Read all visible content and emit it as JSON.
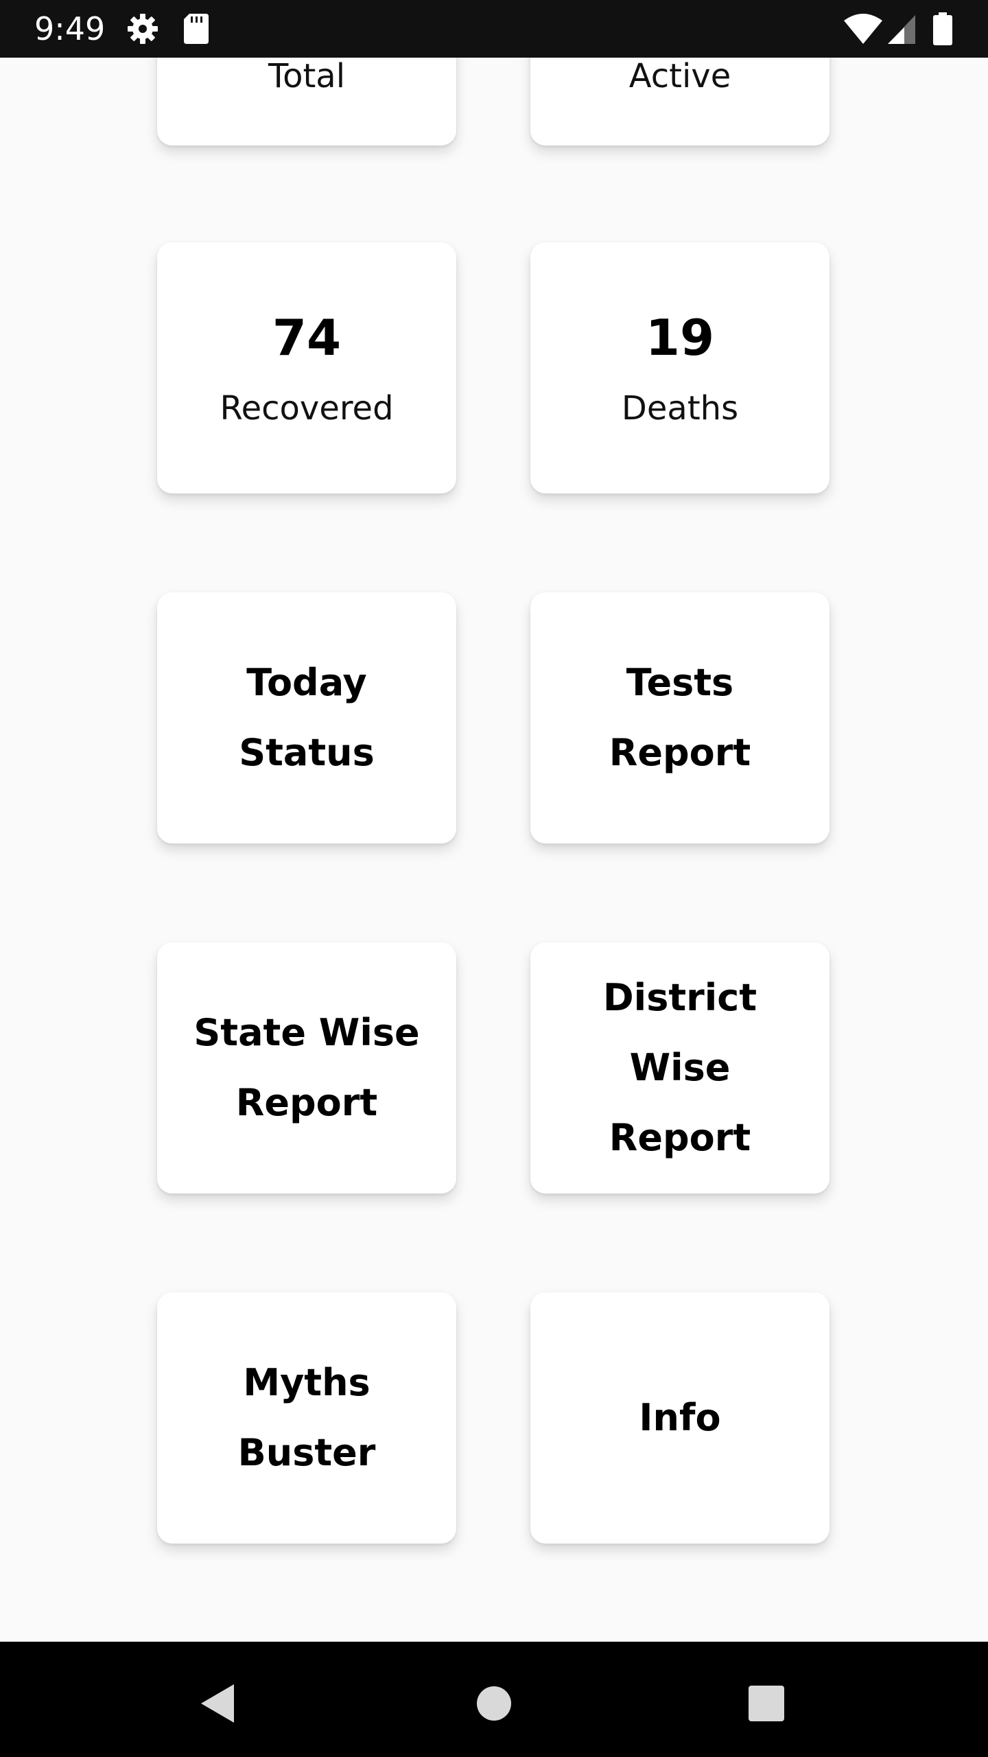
{
  "status_bar": {
    "time": "9:49",
    "icons": [
      "gear-icon",
      "sd-card-icon",
      "wifi-icon",
      "cell-signal-icon",
      "battery-icon"
    ]
  },
  "stats": {
    "total_label": "Total",
    "active_label": "Active",
    "recovered_count": "74",
    "recovered_label": "Recovered",
    "deaths_count": "19",
    "deaths_label": "Deaths"
  },
  "menu": {
    "today_status": "Today Status",
    "tests_report": "Tests Report",
    "state_wise_report": "State Wise Report",
    "district_wise_report": "District Wise Report",
    "myths_buster": "Myths Buster",
    "info": "Info"
  },
  "nav_bar": {
    "buttons": [
      "back-icon",
      "home-icon",
      "recents-icon"
    ]
  },
  "colors": {
    "background": "#fafafa",
    "card": "#ffffff",
    "status_bar": "#111111",
    "nav_bar": "#000000"
  }
}
